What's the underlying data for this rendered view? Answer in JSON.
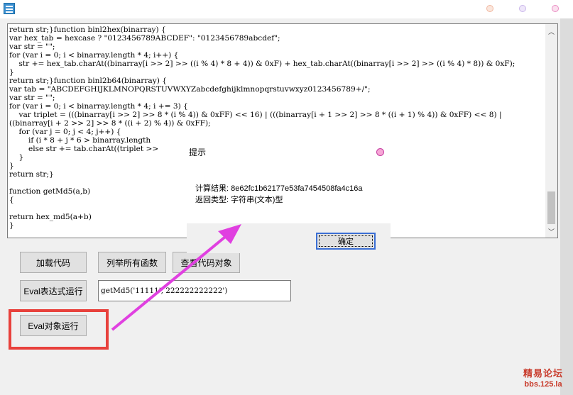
{
  "window": {
    "icon": "app-window-icon",
    "dot_colors": [
      "#f7c9b6",
      "#d9c9ef",
      "#f6b6d8"
    ]
  },
  "editor": {
    "lines": [
      "return str;}function binl2hex(binarray) {",
      "var hex_tab = hexcase ? \"0123456789ABCDEF\": \"0123456789abcdef\";",
      "var str = \"\";",
      "for (var i = 0; i < binarray.length * 4; i++) {",
      "    str += hex_tab.charAt((binarray[i >> 2] >> ((i % 4) * 8 + 4)) & 0xF) + hex_tab.charAt((binarray[i >> 2] >> ((i % 4) * 8)) & 0xF);",
      "}",
      "return str;}function binl2b64(binarray) {",
      "var tab = \"ABCDEFGHIJKLMNOPQRSTUVWXYZabcdefghijklmnopqrstuvwxyz0123456789+/\";",
      "var str = \"\";",
      "for (var i = 0; i < binarray.length * 4; i += 3) {",
      "    var triplet = (((binarray[i >> 2] >> 8 * (i % 4)) & 0xFF) << 16) | (((binarray[i + 1 >> 2] >> 8 * ((i + 1) % 4)) & 0xFF) << 8) | ((binarray[i + 2 >> 2] >> 8 * ((i + 2) % 4)) & 0xFF);",
      "    for (var j = 0; j < 4; j++) {",
      "        if (i * 8 + j * 6 > binarray.length",
      "        else str += tab.charAt((triplet >>",
      "    }",
      "}",
      "return str;}",
      "",
      "function getMd5(a,b)",
      "{",
      "",
      "return hex_md5(a+b)",
      "}"
    ]
  },
  "buttons": {
    "load_code": "加载代码",
    "list_functions": "列举所有函数",
    "query_object": "查看代码对象",
    "eval_expression": "Eval表达式运行",
    "eval_object": "Eval对象运行"
  },
  "expression_input": {
    "value": "getMd5('11111', 222222222222')"
  },
  "dialog": {
    "title": "提示",
    "result_line": "计算结果: 8e62fc1b62177e53fa7454508fa4c16a",
    "type_line": "返回类型: 字符串(文本)型",
    "ok": "确定"
  },
  "annotation": {
    "arrow_color": "#e040e0",
    "box_color": "#e8413c"
  },
  "watermark": {
    "line1": "精易论坛",
    "line2": "bbs.125.la"
  }
}
